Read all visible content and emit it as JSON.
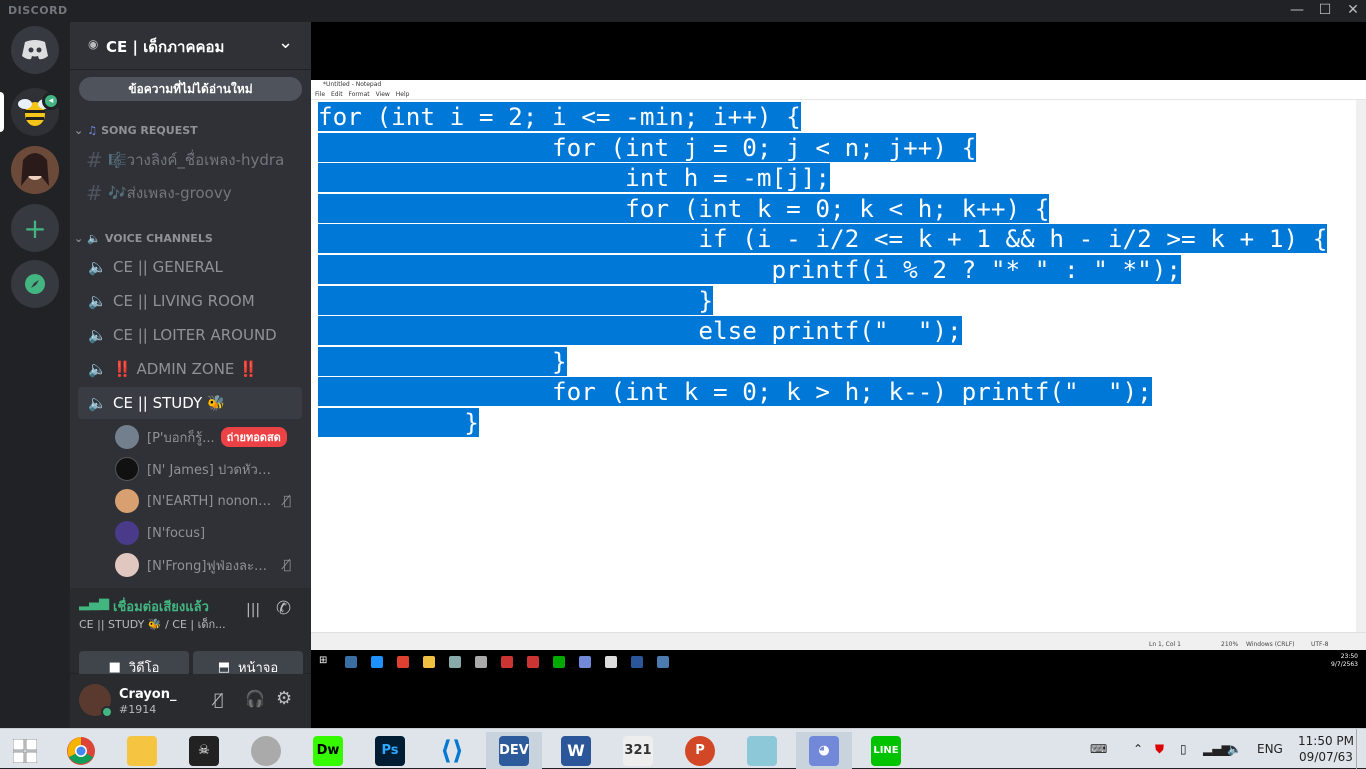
{
  "titlebar": {
    "brand": "DISCORD",
    "minimize": "—",
    "maximize": "☐",
    "close": "✕"
  },
  "server": {
    "name": "CE | เด็กภาคคอม",
    "chevron": "⌄"
  },
  "unread_bar": "ข้อความที่ไม่ได้อ่านใหม่",
  "categories": {
    "song": "SONG REQUEST",
    "voice": "VOICE CHANNELS"
  },
  "text_channels": [
    {
      "label": "🎼วางลิงค์_ชื่อเพลง-hydra"
    },
    {
      "label": "🎶ส่งเพลง-groovy"
    }
  ],
  "voice_channels": [
    {
      "label": "CE || GENERAL"
    },
    {
      "label": "CE || LIVING ROOM"
    },
    {
      "label": "CE || LOITER AROUND"
    },
    {
      "label": "‼️ ADMIN ZONE ‼️"
    },
    {
      "label": "CE || STUDY 🐝"
    }
  ],
  "voice_users": [
    {
      "name": "[P'บอกก็รู้...",
      "badge": "ถ่ายทอดสด"
    },
    {
      "name": "[N' James] ปวดหัวเลย"
    },
    {
      "name": "[N'EARTH] nonono..."
    },
    {
      "name": "[N'focus]"
    },
    {
      "name": "[N'Frong]ฟูฟ่องละอ..."
    }
  ],
  "voice_panel": {
    "status": "เชื่อมต่อเสียงแล้ว",
    "location": "CE || STUDY 🐝 / CE | เด็ก...",
    "video": "วิดีโอ",
    "screen": "หน้าจอ"
  },
  "user": {
    "name": "Crayon_",
    "tag": "#1914"
  },
  "notepad": {
    "title": "*Untitled - Notepad",
    "menu": [
      "File",
      "Edit",
      "Format",
      "View",
      "Help"
    ],
    "code_lines": [
      "for (int i = 2; i <= -min; i++) {",
      "                for (int j = 0; j < n; j++) {",
      "                     int h = -m[j];",
      "                     for (int k = 0; k < h; k++) {",
      "                          if (i - i/2 <= k + 1 && h - i/2 >= k + 1) {",
      "                               printf(i % 2 ? \"* \" : \" *\");",
      "                          }",
      "                          else printf(\"  \");",
      "                }",
      "                for (int k = 0; k > h; k--) printf(\"  \");",
      "          }"
    ],
    "status": {
      "position": "Ln 1, Col 1",
      "zoom": "210%",
      "eol": "Windows (CRLF)",
      "encoding": "UTF-8"
    },
    "mini_clock": {
      "time": "23:50",
      "date": "9/7/2563"
    }
  },
  "taskbar": {
    "lang": "ENG",
    "time": "11:50 PM",
    "date": "09/07/63",
    "apps": [
      "Dw",
      "Ps",
      "DEV",
      "W"
    ]
  },
  "colors": {
    "selection": "#0078d7",
    "discord_bg": "#2f3136",
    "rail": "#202225",
    "voice_green": "#43b581"
  }
}
